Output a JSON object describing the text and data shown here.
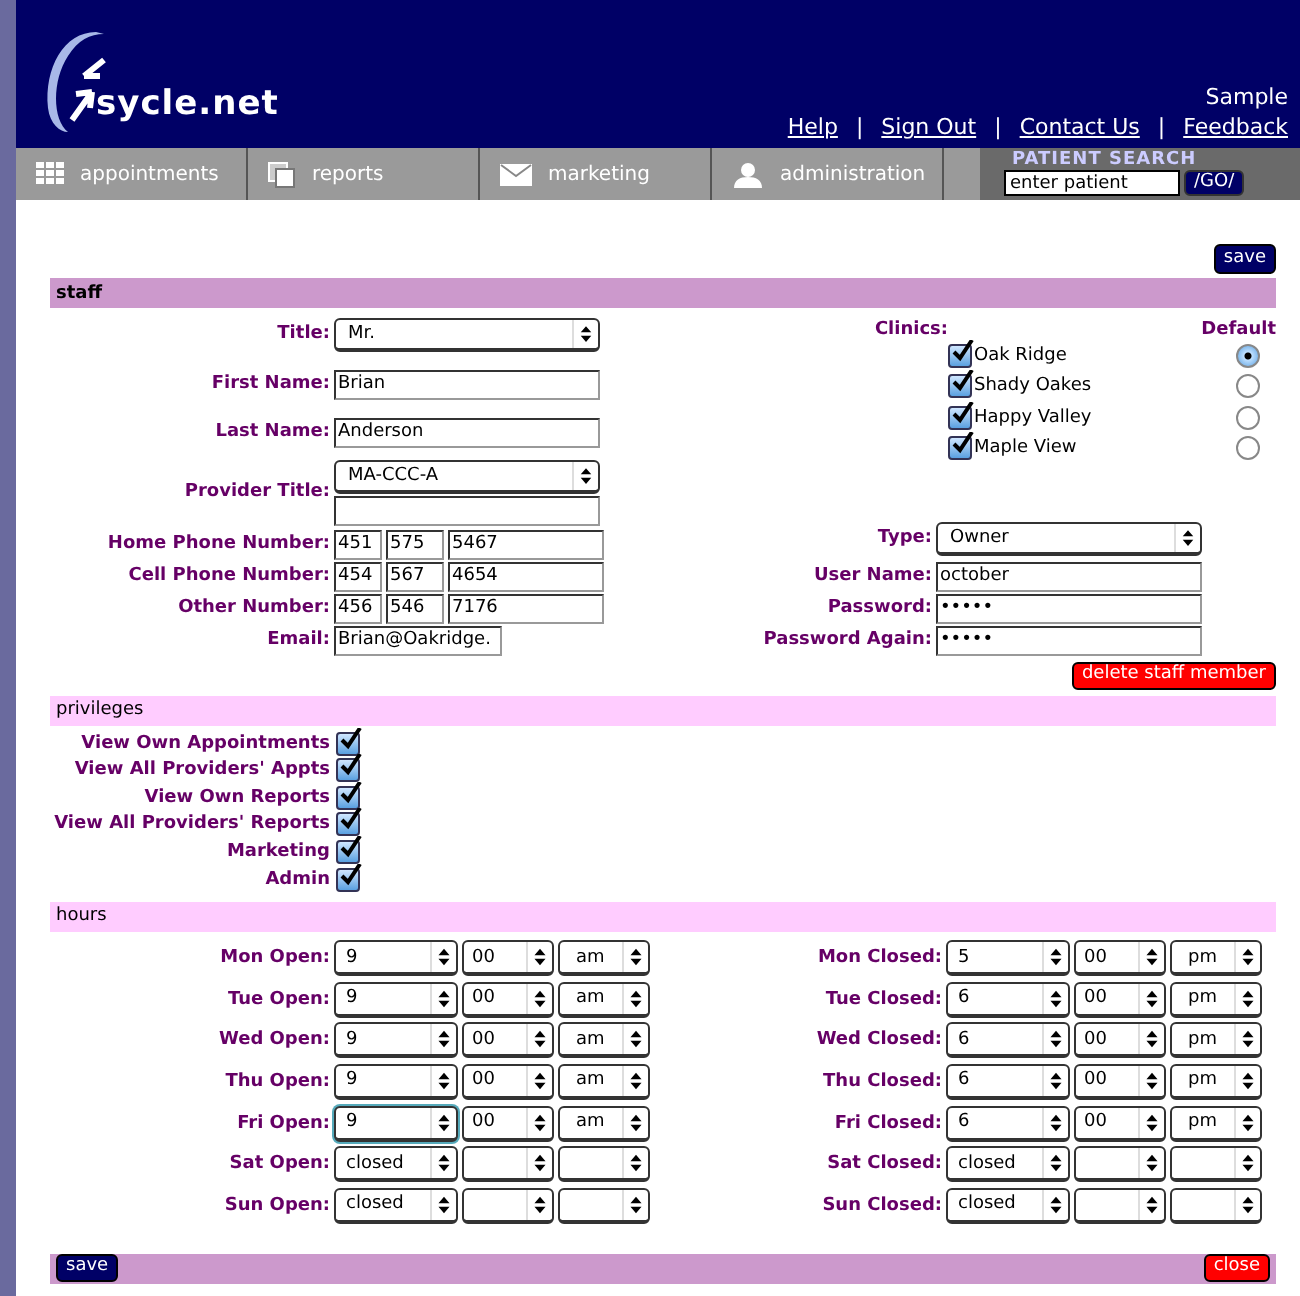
{
  "header": {
    "logo": "sycle.net",
    "account": "Sample",
    "links": [
      "Help",
      "Sign Out",
      "Contact Us",
      "Feedback"
    ],
    "separator": "|"
  },
  "nav": {
    "tabs": [
      {
        "label": "appointments",
        "kind": "grid"
      },
      {
        "label": "reports",
        "kind": "pages"
      },
      {
        "label": "marketing",
        "kind": "mail"
      },
      {
        "label": "administration",
        "kind": "person"
      }
    ],
    "patient_search": {
      "title": "PATIENT SEARCH",
      "value": "enter patient",
      "button": "/GO/"
    }
  },
  "top_button": "save",
  "staff": {
    "title": "staff",
    "fields": [
      {
        "kind": "select",
        "label": "Title:",
        "value": "Mr."
      },
      {
        "kind": "text",
        "label": "First Name:",
        "value": "Brian"
      },
      {
        "kind": "text",
        "label": "Last Name:",
        "value": "Anderson"
      },
      {
        "kind": "select_text",
        "label": "Provider Title:",
        "value": "MA-CCC-A"
      },
      {
        "kind": "phone",
        "label": "Home Phone Number:",
        "parts": [
          "451",
          "575",
          "5467"
        ]
      },
      {
        "kind": "phone",
        "label": "Cell Phone Number:",
        "parts": [
          "454",
          "567",
          "4654"
        ]
      },
      {
        "kind": "phone",
        "label": "Other Number:",
        "parts": [
          "456",
          "546",
          "7176"
        ]
      },
      {
        "kind": "email",
        "label": "Email:",
        "value": "Brian@Oakridge."
      }
    ],
    "clinics_label": "Clinics:",
    "default_label": "Default",
    "clinics": [
      {
        "name": "Oak Ridge",
        "checked": true,
        "selected": true
      },
      {
        "name": "Shady Oakes",
        "checked": true,
        "selected": false
      },
      {
        "name": "Happy Valley",
        "checked": true,
        "selected": false
      },
      {
        "name": "Maple View",
        "checked": true,
        "selected": false
      }
    ],
    "account": [
      {
        "kind": "select",
        "label": "Type:",
        "value": "Owner"
      },
      {
        "kind": "text",
        "label": "User Name:",
        "value": "october"
      },
      {
        "kind": "password",
        "label": "Password:",
        "value": "•••••"
      },
      {
        "kind": "password",
        "label": "Password Again:",
        "value": "•••••"
      }
    ],
    "delete_button": "delete staff member"
  },
  "privileges": {
    "title": "privileges",
    "items": [
      {
        "label": "View Own Appointments",
        "checked": true
      },
      {
        "label": "View All Providers' Appts",
        "checked": true
      },
      {
        "label": "View Own Reports",
        "checked": true
      },
      {
        "label": "View All Providers' Reports",
        "checked": true
      },
      {
        "label": "Marketing",
        "checked": true
      },
      {
        "label": "Admin",
        "checked": true
      }
    ]
  },
  "hours": {
    "title": "hours",
    "open": [
      {
        "label": "Mon Open:",
        "hour": "9",
        "minute": "00",
        "ampm": "am"
      },
      {
        "label": "Tue Open:",
        "hour": "9",
        "minute": "00",
        "ampm": "am"
      },
      {
        "label": "Wed Open:",
        "hour": "9",
        "minute": "00",
        "ampm": "am"
      },
      {
        "label": "Thu Open:",
        "hour": "9",
        "minute": "00",
        "ampm": "am"
      },
      {
        "label": "Fri Open:",
        "hour": "9",
        "minute": "00",
        "ampm": "am"
      },
      {
        "label": "Sat Open:",
        "hour": "closed"
      },
      {
        "label": "Sun Open:",
        "hour": "closed"
      }
    ],
    "closed": [
      {
        "label": "Mon Closed:",
        "hour": "5",
        "minute": "00",
        "ampm": "pm"
      },
      {
        "label": "Tue Closed:",
        "hour": "6",
        "minute": "00",
        "ampm": "pm"
      },
      {
        "label": "Wed Closed:",
        "hour": "6",
        "minute": "00",
        "ampm": "pm"
      },
      {
        "label": "Thu Closed:",
        "hour": "6",
        "minute": "00",
        "ampm": "pm"
      },
      {
        "label": "Fri Closed:",
        "hour": "6",
        "minute": "00",
        "ampm": "pm"
      },
      {
        "label": "Sat Closed:",
        "hour": "closed"
      },
      {
        "label": "Sun Closed:",
        "hour": "closed"
      }
    ]
  },
  "footer": {
    "save": "save",
    "close": "close"
  }
}
